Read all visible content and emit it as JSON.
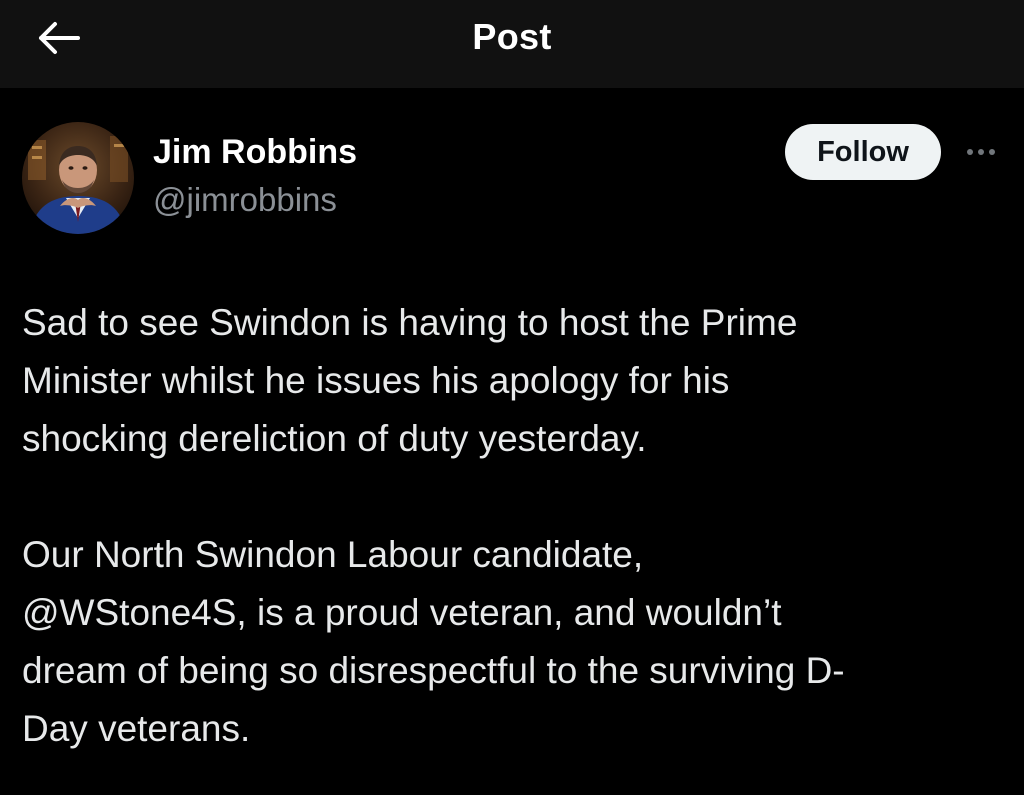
{
  "header": {
    "title": "Post",
    "back_icon": "arrow-left-icon"
  },
  "author": {
    "name": "Jim Robbins",
    "handle": "@jimrobbins",
    "avatar_icon": "profile-photo"
  },
  "actions": {
    "follow_label": "Follow",
    "more_icon": "more-horizontal-icon"
  },
  "post": {
    "paragraphs": [
      "Sad to see Swindon is having to host the Prime\nMinister whilst he issues his apology for his\nshocking dereliction of duty yesterday.",
      "Our North Swindon Labour candidate,\n@WStone4S, is a proud veteran, and wouldn’t\ndream of being so disrespectful to the surviving D-\nDay veterans."
    ]
  },
  "colors": {
    "background": "#000000",
    "header_background": "#111111",
    "text": "#e7e9ea",
    "secondary_text": "#8b9096",
    "follow_button_bg": "#eff3f4"
  }
}
